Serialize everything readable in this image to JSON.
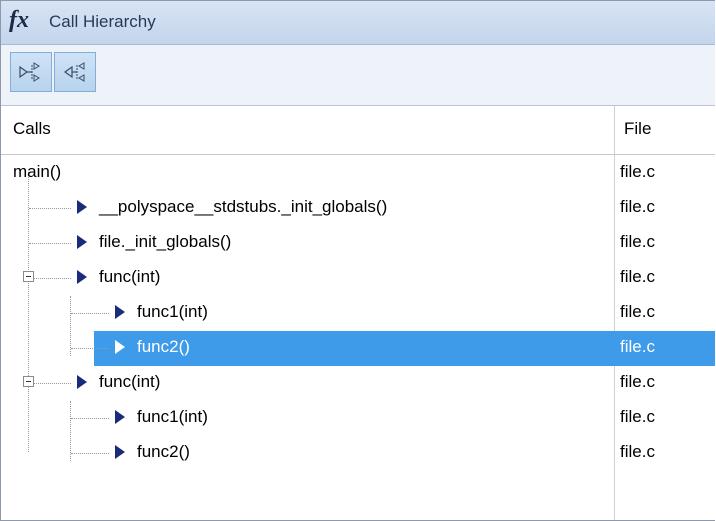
{
  "window": {
    "title_icon": "fx",
    "title": "Call Hierarchy"
  },
  "toolbar": {
    "buttons": [
      {
        "name": "show-callers-icon"
      },
      {
        "name": "show-callees-icon"
      }
    ]
  },
  "table": {
    "columns": [
      "Calls",
      "File"
    ],
    "rows": [
      {
        "label": "main()",
        "file": "file.c",
        "depth": 0,
        "expandable": false,
        "has_arrow": false,
        "selected": false
      },
      {
        "label": "__polyspace__stdstubs._init_globals()",
        "file": "file.c",
        "depth": 1,
        "expandable": false,
        "has_arrow": true,
        "selected": false
      },
      {
        "label": "file._init_globals()",
        "file": "file.c",
        "depth": 1,
        "expandable": false,
        "has_arrow": true,
        "selected": false
      },
      {
        "label": "func(int)",
        "file": "file.c",
        "depth": 1,
        "expandable": true,
        "has_arrow": true,
        "selected": false
      },
      {
        "label": "func1(int)",
        "file": "file.c",
        "depth": 2,
        "expandable": false,
        "has_arrow": true,
        "selected": false
      },
      {
        "label": "func2()",
        "file": "file.c",
        "depth": 2,
        "expandable": false,
        "has_arrow": true,
        "selected": true
      },
      {
        "label": "func(int)",
        "file": "file.c",
        "depth": 1,
        "expandable": true,
        "has_arrow": true,
        "selected": false
      },
      {
        "label": "func1(int)",
        "file": "file.c",
        "depth": 2,
        "expandable": false,
        "has_arrow": true,
        "selected": false
      },
      {
        "label": "func2()",
        "file": "file.c",
        "depth": 2,
        "expandable": false,
        "has_arrow": true,
        "selected": false
      }
    ]
  },
  "colors": {
    "selection": "#3d9be9",
    "arrow": "#1a2b7a",
    "titlebar": "#c3d5ec"
  }
}
